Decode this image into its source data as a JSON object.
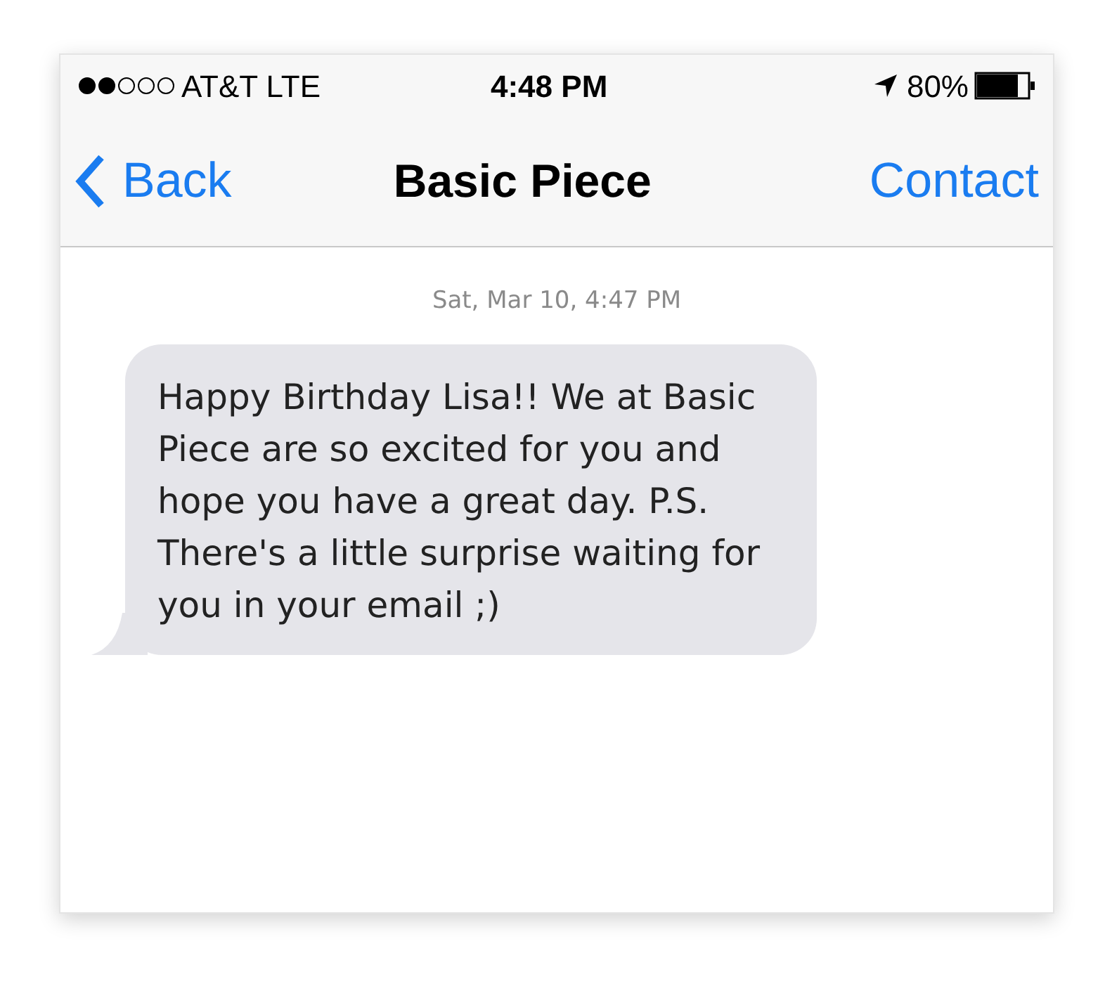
{
  "status_bar": {
    "carrier": "AT&T LTE",
    "time": "4:48 PM",
    "battery": "80%"
  },
  "nav_bar": {
    "back": "Back",
    "title": "Basic Piece",
    "action": "Contact"
  },
  "messages": [
    {
      "kind": "timestamp",
      "text": "Sat, Mar 10, 4:47 PM"
    },
    {
      "kind": "incoming",
      "text": "Happy Birthday Lisa!! We at Basic Piece are so excited for you and hope you have a great day. P.S. There's a little surprise waiting for you in your email ;)"
    }
  ]
}
